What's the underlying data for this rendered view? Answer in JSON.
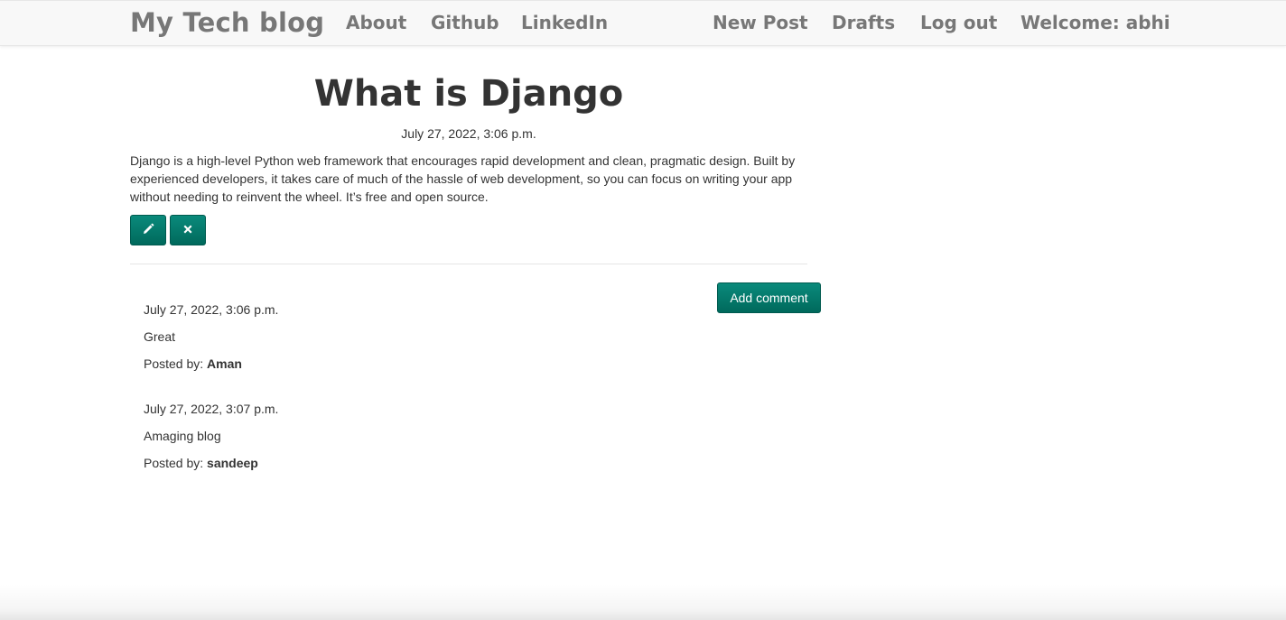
{
  "navbar": {
    "brand": "My Tech blog",
    "left_links": [
      "About",
      "Github",
      "LinkedIn"
    ],
    "right_links": [
      "New Post",
      "Drafts",
      "Log out"
    ],
    "welcome": "Welcome: abhi"
  },
  "post": {
    "title": "What is Django",
    "date": "July 27, 2022, 3:06 p.m.",
    "body": "Django is a high-level Python web framework that encourages rapid development and clean, pragmatic design. Built by experienced developers, it takes care of much of the hassle of web development, so you can focus on writing your app without needing to reinvent the wheel. It’s free and open source.",
    "edit_icon": "pencil-icon",
    "delete_icon": "remove-icon"
  },
  "comments_section": {
    "add_comment_label": "Add comment",
    "posted_by_label": "Posted by:",
    "comments": [
      {
        "date": "July 27, 2022, 3:06 p.m.",
        "text": "Great",
        "author": "Aman"
      },
      {
        "date": "July 27, 2022, 3:07 p.m.",
        "text": "Amaging blog",
        "author": "sandeep"
      }
    ]
  },
  "colors": {
    "button": "#00796b",
    "nav_text": "#777777",
    "text": "#333333",
    "navbar_bg": "#f8f8f8"
  }
}
